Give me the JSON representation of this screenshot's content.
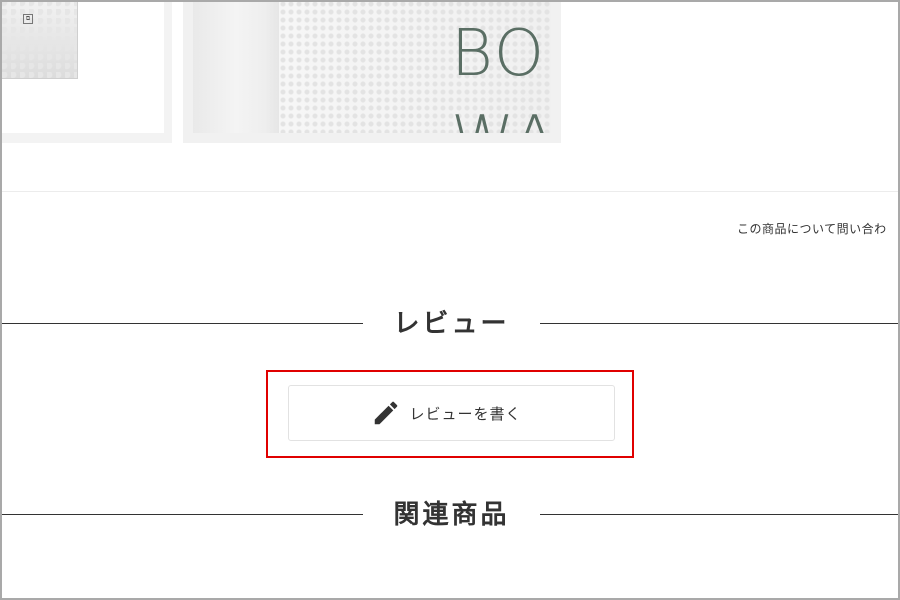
{
  "thumbnails": {
    "right_photo_text_line1": "BO",
    "right_photo_text_line2": "WA"
  },
  "product": {
    "inquiry_link": "この商品について問い合わ"
  },
  "reviews": {
    "heading": "レビュー",
    "write_button_label": "レビューを書く",
    "write_button_icon": "pencil-icon"
  },
  "related": {
    "heading": "関連商品"
  },
  "colors": {
    "highlight": "#e00000",
    "text": "#333333",
    "divider": "#333333"
  }
}
